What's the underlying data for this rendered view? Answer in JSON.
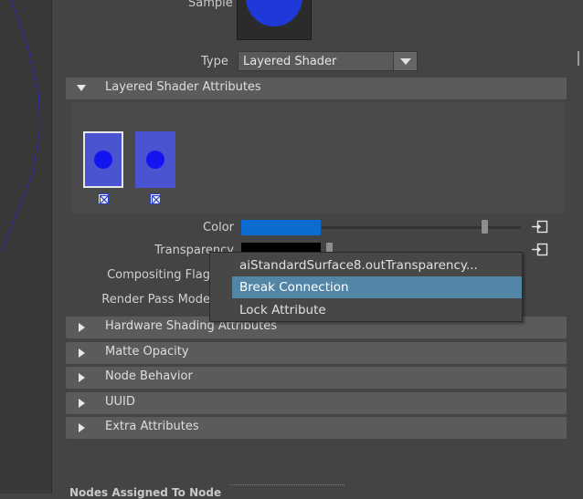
{
  "sample": {
    "label": "Sample"
  },
  "type_field": {
    "label": "Type",
    "value": "Layered Shader"
  },
  "sections": {
    "layered": "Layered Shader Attributes",
    "hardware": "Hardware Shading Attributes",
    "matte": "Matte Opacity",
    "node": "Node Behavior",
    "uuid": "UUID",
    "extra": "Extra Attributes"
  },
  "attributes": {
    "color": "Color",
    "transparency": "Transparency",
    "compositing": "Compositing Flag",
    "render_pass": "Render Pass Mode"
  },
  "context_menu": {
    "items": [
      {
        "label": "aiStandardSurface8.outTransparency..."
      },
      {
        "label": "Break Connection"
      },
      {
        "label": "Lock Attribute"
      }
    ]
  },
  "colors": {
    "color_swatch": "#0a6ccf",
    "layer_swatch": "#4b54d0",
    "sample_ball": "#1f38d8",
    "menu_highlight": "#5285a6"
  },
  "footer": {
    "text": "Nodes Assigned To Node"
  }
}
